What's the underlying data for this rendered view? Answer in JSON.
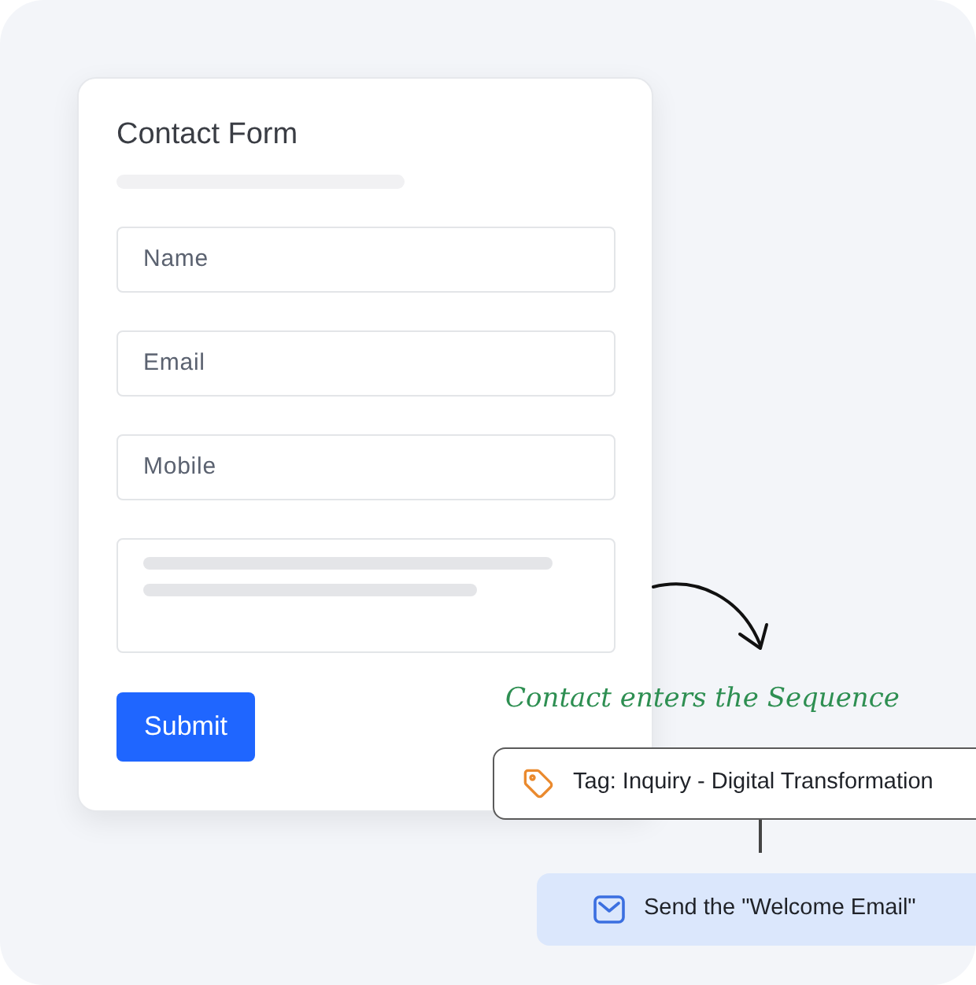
{
  "form": {
    "title": "Contact Form",
    "fields": [
      {
        "kind": "input",
        "placeholder": "Name"
      },
      {
        "kind": "input",
        "placeholder": "Email"
      },
      {
        "kind": "input",
        "placeholder": "Mobile"
      },
      {
        "kind": "textarea"
      }
    ],
    "submit": "Submit"
  },
  "annotation": "Contact enters the Sequence",
  "steps": [
    {
      "kind": "tag",
      "text": "Tag: Inquiry - Digital Transformation"
    },
    {
      "kind": "email",
      "text": "Send the \"Welcome Email\""
    }
  ]
}
